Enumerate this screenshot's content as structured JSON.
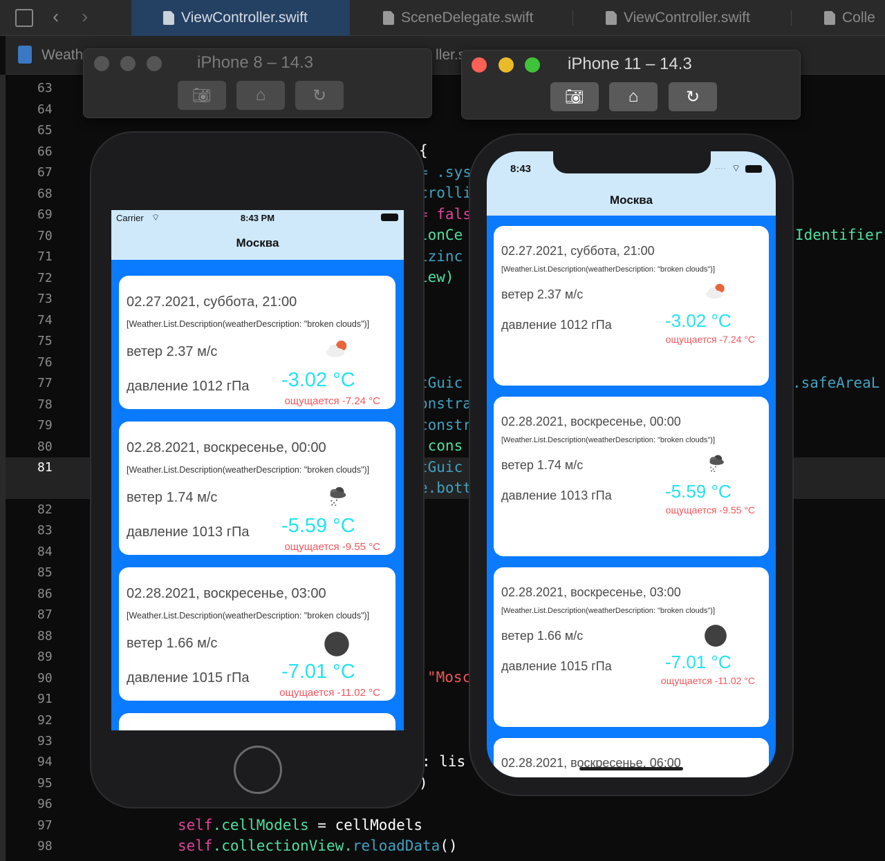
{
  "tabs": [
    {
      "label": "ViewController.swift",
      "active": true
    },
    {
      "label": "SceneDelegate.swift",
      "active": false
    },
    {
      "label": "ViewController.swift",
      "active": false
    },
    {
      "label": "Colle",
      "active": false
    }
  ],
  "jumpbar": {
    "project": "Weath",
    "file_fragment": "ller.s"
  },
  "editor": {
    "line_numbers": [
      "63",
      "64",
      "65",
      "66",
      "67",
      "68",
      "69",
      "70",
      "71",
      "72",
      "73",
      "74",
      "75",
      "76",
      "77",
      "78",
      "79",
      "80",
      "81",
      "82",
      "83",
      "84",
      "85",
      "86",
      "87",
      "88",
      "89",
      "90",
      "91",
      "92",
      "93",
      "94",
      "95",
      "96",
      "97",
      "98"
    ],
    "current_line": "81",
    "fragments": {
      "brace": "{",
      "sys": "= .sys",
      "scroll": "crolli",
      "false": "= fals",
      "oncell": "lonCe",
      "sizing": "izinc",
      "view": "iew)",
      "guide1": "tGuic",
      "constra": "onstra",
      "constr": "constr",
      "cons": ".cons",
      "guide2": "tGuic",
      "bott": "e.bott",
      "mosc": "\"Mosc",
      "lis": ": lis",
      "paren": ")",
      "identifier": "Identifier",
      "safe": ".safeAreaL",
      "line97": [
        "self",
        ".cellModels",
        " = cellModels"
      ],
      "line98": [
        "self",
        ".collectionView.",
        "reloadData",
        "()"
      ]
    }
  },
  "colors": {
    "accent_blue": "#0a7aff",
    "nav_bg": "#cfe9fb",
    "temp": "#22e3f2",
    "feels": "#f2555a",
    "traffic_red": "#fe5f57",
    "traffic_yellow": "#febc2e",
    "traffic_green": "#28c840"
  },
  "sim8": {
    "title": "iPhone 8 – 14.3",
    "carrier": "Carrier",
    "time": "8:43 PM",
    "nav_title": "Москва",
    "cells": [
      {
        "date": "02.27.2021, суббота, 21:00",
        "desc": "[Weather.List.Description(weatherDescription: \"broken clouds\")]",
        "wind": "ветер 2.37 м/с",
        "pressure": "давление 1012 гПа",
        "temp": "-3.02 °C",
        "feels": "ощущается -7.24 °C",
        "icon": "cloud-sun-icon"
      },
      {
        "date": "02.28.2021, воскресенье, 00:00",
        "desc": "[Weather.List.Description(weatherDescription: \"broken clouds\")]",
        "wind": "ветер 1.74 м/с",
        "pressure": "давление 1013 гПа",
        "temp": "-5.59 °C",
        "feels": "ощущается -9.55 °C",
        "icon": "snow-cloud-icon"
      },
      {
        "date": "02.28.2021, воскресенье, 03:00",
        "desc": "[Weather.List.Description(weatherDescription: \"broken clouds\")]",
        "wind": "ветер 1.66 м/с",
        "pressure": "давление 1015 гПа",
        "temp": "-7.01 °C",
        "feels": "ощущается -11.02 °C",
        "icon": "dark-circle-icon"
      },
      {}
    ]
  },
  "sim11": {
    "title": "iPhone 11 – 14.3",
    "time": "8:43",
    "nav_title": "Москва",
    "cells": [
      {
        "date": "02.27.2021, суббота, 21:00",
        "desc": "[Weather.List.Description(weatherDescription: \"broken clouds\")]",
        "wind": "ветер 2.37 м/с",
        "pressure": "давление 1012 гПа",
        "temp": "-3.02 °C",
        "feels": "ощущается -7.24 °C",
        "icon": "cloud-sun-icon"
      },
      {
        "date": "02.28.2021, воскресенье, 00:00",
        "desc": "[Weather.List.Description(weatherDescription: \"broken clouds\")]",
        "wind": "ветер 1.74 м/с",
        "pressure": "давление 1013 гПа",
        "temp": "-5.59 °C",
        "feels": "ощущается -9.55 °C",
        "icon": "snow-cloud-icon"
      },
      {
        "date": "02.28.2021, воскресенье, 03:00",
        "desc": "[Weather.List.Description(weatherDescription: \"broken clouds\")]",
        "wind": "ветер 1.66 м/с",
        "pressure": "давление 1015 гПа",
        "temp": "-7.01 °C",
        "feels": "ощущается -11.02 °C",
        "icon": "dark-circle-icon"
      },
      {
        "date": "02.28.2021, воскресенье, 06:00"
      }
    ]
  }
}
